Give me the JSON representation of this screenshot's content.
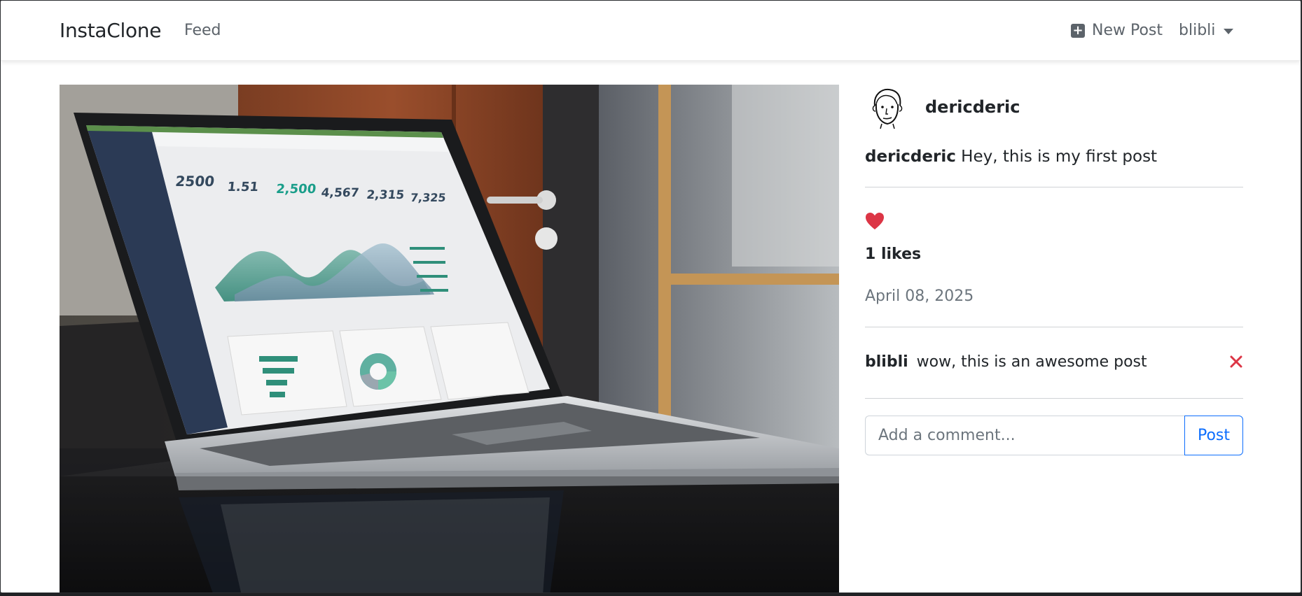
{
  "navbar": {
    "brand": "InstaClone",
    "feed_link": "Feed",
    "new_post": "New Post",
    "user_menu": "blibli"
  },
  "post": {
    "author": "dericderic",
    "caption_author": "dericderic",
    "caption_text": "Hey, this is my first post",
    "likes": "1 likes",
    "date": "April 08, 2025",
    "image_description": "laptop-showing-analytics-dashboard"
  },
  "comments": [
    {
      "user": "blibli",
      "text": "wow, this is an awesome post"
    }
  ],
  "comment_form": {
    "placeholder": "Add a comment...",
    "submit_label": "Post"
  },
  "colors": {
    "heart": "#dc3545",
    "delete": "#dc3545",
    "accent": "#0d6efd"
  },
  "icons": {
    "new_post": "plus-square-icon",
    "user_menu": "caret-down-icon",
    "like": "heart-icon",
    "delete_comment": "close-icon"
  }
}
